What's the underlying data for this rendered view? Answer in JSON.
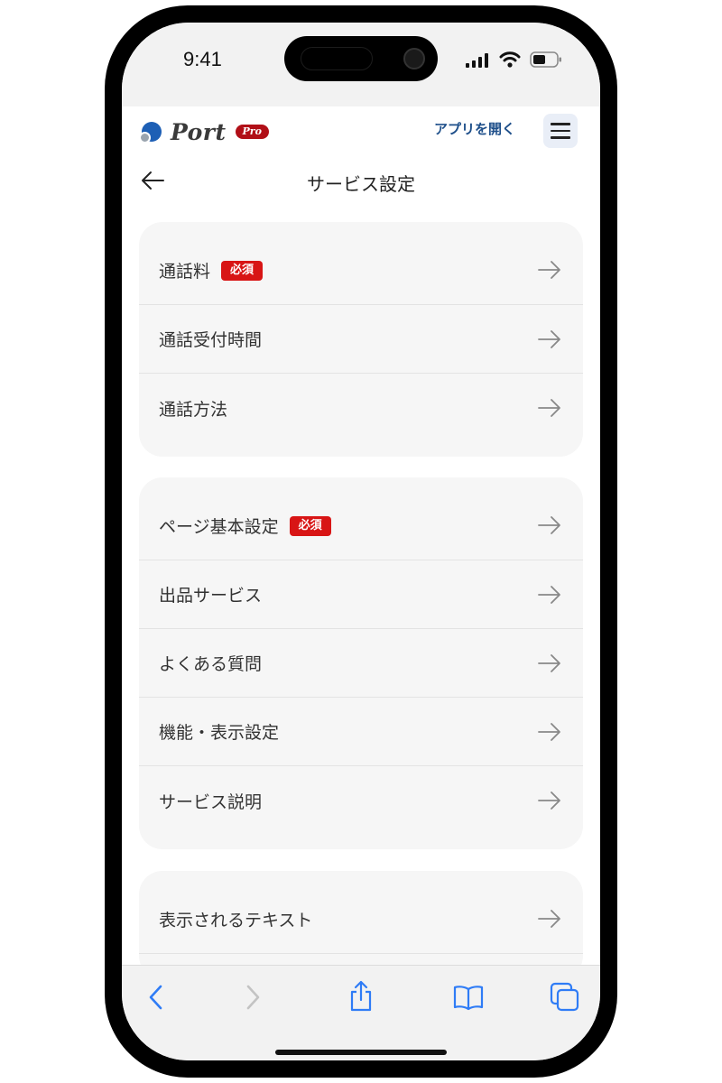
{
  "status_bar": {
    "time": "9:41"
  },
  "header": {
    "logo_text": "Port",
    "logo_badge": "Pro",
    "open_app_label": "アプリを開く",
    "accent_color": "#1e4f8a"
  },
  "nav": {
    "title": "サービス設定"
  },
  "required_badge_color": "#d81515",
  "sections": [
    {
      "items": [
        {
          "label": "通話料",
          "badge": "必須"
        },
        {
          "label": "通話受付時間",
          "badge": ""
        },
        {
          "label": "通話方法",
          "badge": ""
        }
      ]
    },
    {
      "items": [
        {
          "label": "ページ基本設定",
          "badge": "必須"
        },
        {
          "label": "出品サービス",
          "badge": ""
        },
        {
          "label": "よくある質問",
          "badge": ""
        },
        {
          "label": "機能・表示設定",
          "badge": ""
        },
        {
          "label": "サービス説明",
          "badge": ""
        }
      ]
    },
    {
      "items": [
        {
          "label": "表示されるテキスト",
          "badge": ""
        }
      ]
    }
  ],
  "toolbar": {
    "icons": [
      "back-icon",
      "forward-icon",
      "share-icon",
      "bookmarks-icon",
      "tabs-icon"
    ]
  }
}
